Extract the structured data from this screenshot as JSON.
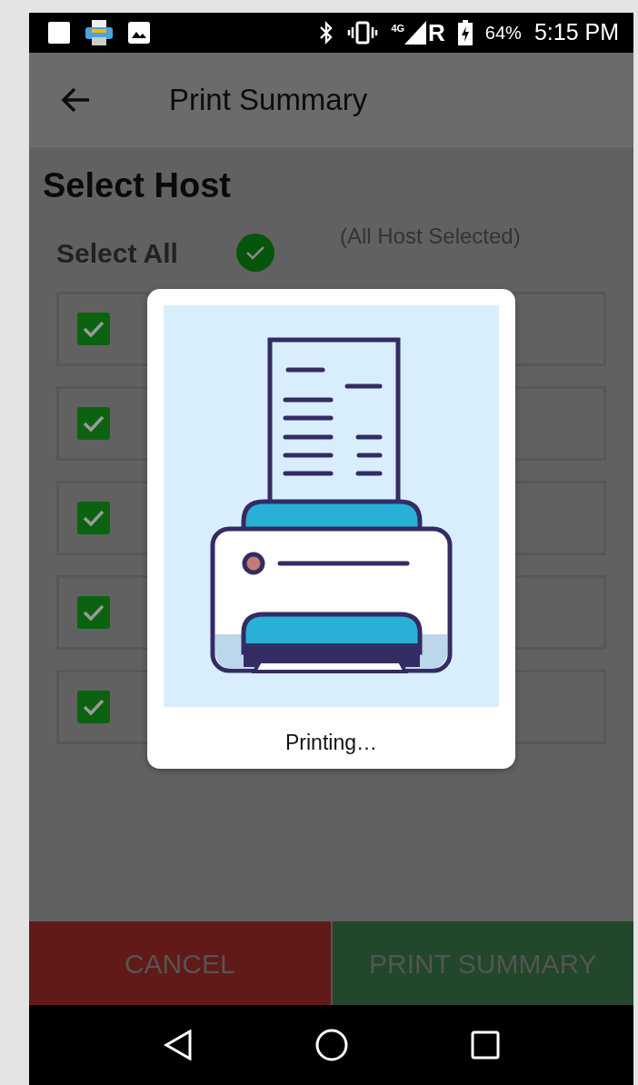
{
  "status_bar": {
    "network": "4G",
    "roaming": "R",
    "battery": "64%",
    "time": "5:15 PM"
  },
  "app_bar": {
    "title": "Print Summary"
  },
  "heading": "Select Host",
  "select_all": {
    "label": "Select All",
    "checked": true,
    "note": "(All Host Selected)"
  },
  "hosts": [
    {
      "checked": true
    },
    {
      "checked": true
    },
    {
      "checked": true
    },
    {
      "checked": true
    },
    {
      "checked": true
    }
  ],
  "dialog": {
    "message": "Printing…"
  },
  "buttons": [
    {
      "label": "CANCEL",
      "kind": "cancel"
    },
    {
      "label": "PRINT SUMMARY",
      "kind": "confirm"
    }
  ]
}
